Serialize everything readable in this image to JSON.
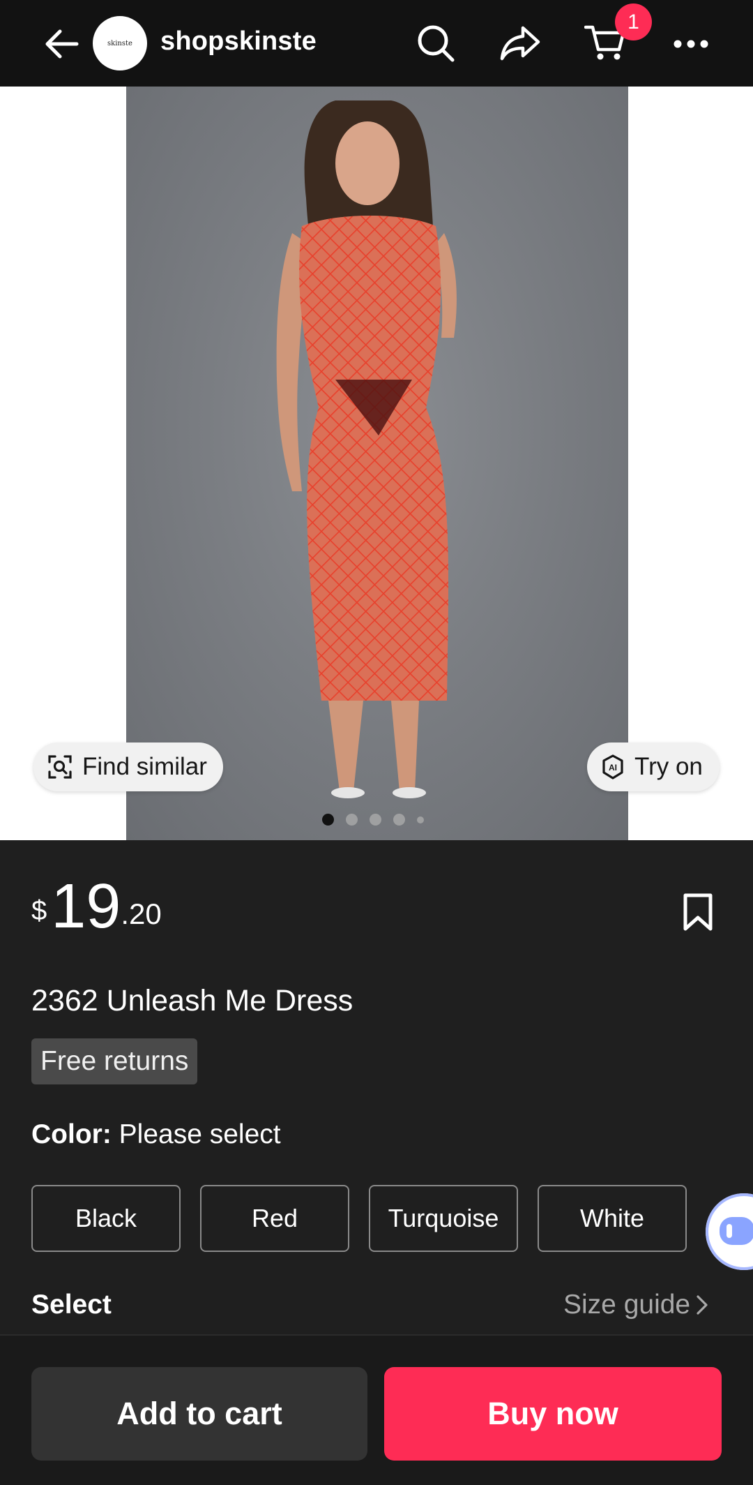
{
  "header": {
    "shop_name": "shopskinste",
    "avatar_text": "skinste",
    "cart_count": "1",
    "icons": [
      "back-arrow-icon",
      "search-icon",
      "share-icon",
      "cart-icon",
      "more-icon"
    ]
  },
  "gallery": {
    "find_similar_label": "Find similar",
    "try_on_label": "Try on",
    "page_count": 5,
    "current_page": 1
  },
  "product": {
    "currency": "$",
    "price_int": "19",
    "price_dec": ".20",
    "title": "2362 Unleash Me Dress",
    "tag": "Free returns",
    "color_label": "Color:",
    "color_value": "Please select",
    "colors": [
      "Black",
      "Red",
      "Turquoise",
      "White"
    ],
    "select_label": "Select",
    "size_guide": "Size guide"
  },
  "actions": {
    "add_to_cart": "Add to cart",
    "buy_now": "Buy now"
  },
  "theme": {
    "accent": "#fe2c55",
    "background": "#1f1f1f",
    "topbar": "#121212"
  }
}
